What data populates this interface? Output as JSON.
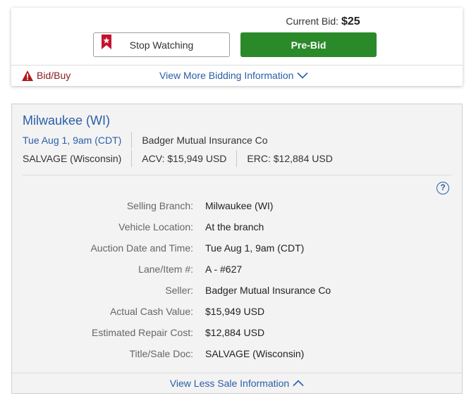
{
  "bid": {
    "current_bid_label": "Current Bid:",
    "current_bid_value": "$25",
    "stop_watching_label": "Stop Watching",
    "prebid_label": "Pre-Bid",
    "bidbuy_label": "Bid/Buy",
    "more_info_label": "View More Bidding Information"
  },
  "sale": {
    "location_title": "Milwaukee (WI)",
    "date_link": "Tue Aug 1, 9am (CDT)",
    "seller_summary": "Badger Mutual Insurance Co",
    "title_doc_summary": "SALVAGE (Wisconsin)",
    "acv_summary": "ACV: $15,949 USD",
    "erc_summary": "ERC: $12,884 USD",
    "help_label": "?",
    "details": [
      {
        "label": "Selling Branch:",
        "value": "Milwaukee (WI)"
      },
      {
        "label": "Vehicle Location:",
        "value": "At the branch"
      },
      {
        "label": "Auction Date and Time:",
        "value": "Tue Aug 1, 9am (CDT)"
      },
      {
        "label": "Lane/Item #:",
        "value": "A - #627"
      },
      {
        "label": "Seller:",
        "value": "Badger Mutual Insurance Co"
      },
      {
        "label": "Actual Cash Value:",
        "value": "$15,949 USD"
      },
      {
        "label": "Estimated Repair Cost:",
        "value": "$12,884 USD"
      },
      {
        "label": "Title/Sale Doc:",
        "value": "SALVAGE (Wisconsin)"
      }
    ],
    "less_info_label": "View Less Sale Information"
  },
  "colors": {
    "link": "#2a5ea8",
    "prebid_green": "#2a8a2a",
    "warning_red": "#8a1a1a",
    "bookmark_red": "#c8102e"
  },
  "icons": {
    "bookmark": "bookmark-star-icon",
    "warning": "warning-icon",
    "chevron_down": "chevron-down-icon",
    "chevron_up": "chevron-up-icon",
    "help": "help-icon"
  }
}
